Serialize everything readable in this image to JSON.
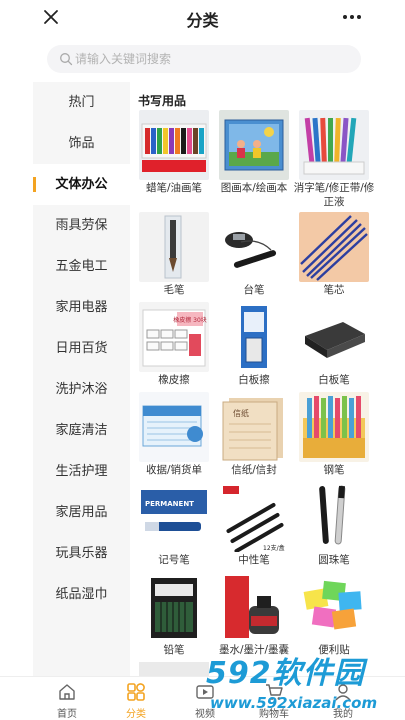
{
  "header": {
    "title": "分类",
    "close_icon": "close-icon",
    "more_icon": "more-icon"
  },
  "search": {
    "placeholder": "请输入关键词搜索",
    "value": ""
  },
  "sidebar": {
    "items": [
      {
        "label": "热门",
        "active": false
      },
      {
        "label": "饰品",
        "active": false
      },
      {
        "label": "文体办公",
        "active": true
      },
      {
        "label": "雨具劳保",
        "active": false
      },
      {
        "label": "五金电工",
        "active": false
      },
      {
        "label": "家用电器",
        "active": false
      },
      {
        "label": "日用百货",
        "active": false
      },
      {
        "label": "洗护沐浴",
        "active": false
      },
      {
        "label": "家庭清洁",
        "active": false
      },
      {
        "label": "生活护理",
        "active": false
      },
      {
        "label": "家居用品",
        "active": false
      },
      {
        "label": "玩具乐器",
        "active": false
      },
      {
        "label": "纸品湿巾",
        "active": false
      }
    ]
  },
  "content": {
    "section_title": "书写用品",
    "products": [
      {
        "name": "蜡笔/油画笔"
      },
      {
        "name": "图画本/绘画本"
      },
      {
        "name": "消字笔/修正带/修正液"
      },
      {
        "name": "毛笔"
      },
      {
        "name": "台笔"
      },
      {
        "name": "笔芯"
      },
      {
        "name": "橡皮擦"
      },
      {
        "name": "白板擦"
      },
      {
        "name": "白板笔"
      },
      {
        "name": "收据/销货单"
      },
      {
        "name": "信纸/信封"
      },
      {
        "name": "钢笔"
      },
      {
        "name": "记号笔"
      },
      {
        "name": "中性笔"
      },
      {
        "name": "圆珠笔"
      },
      {
        "name": "铅笔"
      },
      {
        "name": "墨水/墨汁/墨囊"
      },
      {
        "name": "便利贴"
      }
    ],
    "image_text": {
      "eraser_box": "橡皮擦 30块",
      "pen_pack": "12支/盒",
      "notepad": "信纸",
      "marker": "PERMANENT"
    }
  },
  "tabbar": {
    "items": [
      {
        "label": "首页",
        "icon": "home-icon",
        "active": false
      },
      {
        "label": "分类",
        "icon": "category-icon",
        "active": true
      },
      {
        "label": "视频",
        "icon": "video-icon",
        "active": false
      },
      {
        "label": "购物车",
        "icon": "cart-icon",
        "active": false
      },
      {
        "label": "我的",
        "icon": "user-icon",
        "active": false
      }
    ]
  },
  "watermark": {
    "big": "592软件园",
    "small": "www.592xiazai.com"
  },
  "colors": {
    "accent": "#f3a321",
    "watermark": "#1d9bd6",
    "sidebar_bg": "#f6f6f6"
  }
}
